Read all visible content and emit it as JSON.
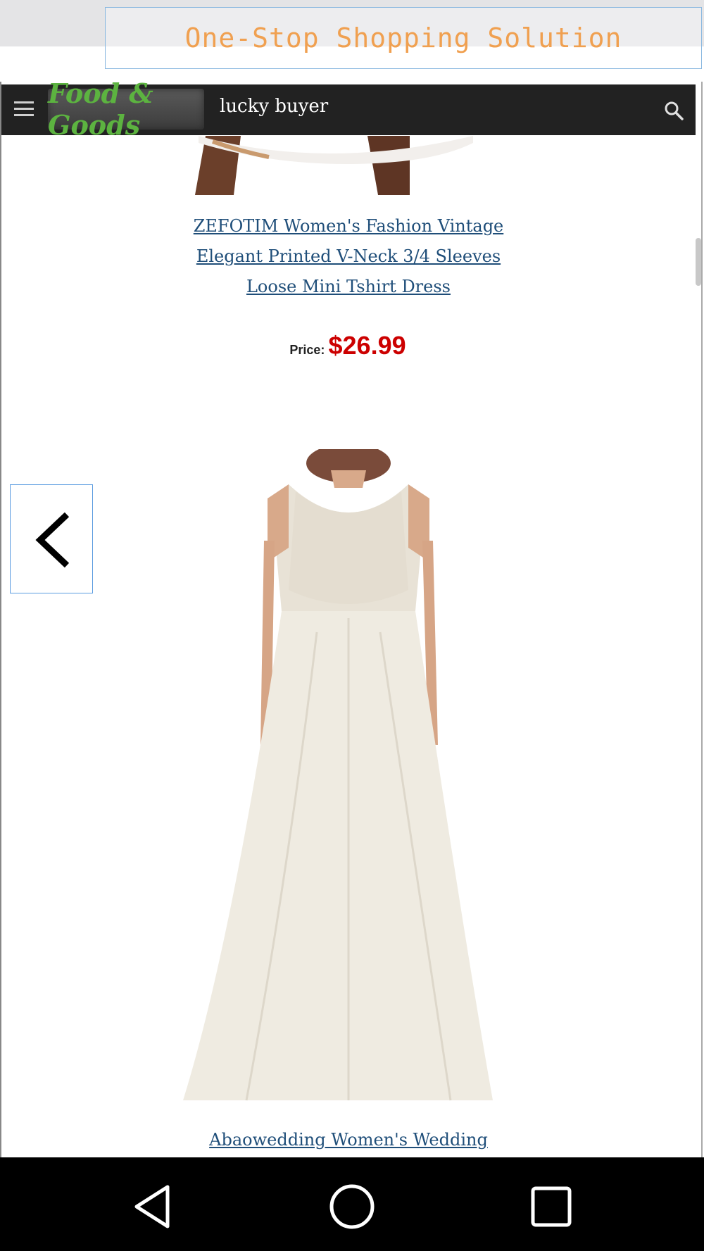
{
  "banner": {
    "text": "One-Stop Shopping Solution"
  },
  "navbar": {
    "logo_text": "Food & Goods",
    "search_value": "lucky buyer"
  },
  "products": [
    {
      "title_lines": [
        "ZEFOTIM Women's Fashion Vintage",
        "Elegant Printed V-Neck 3/4 Sleeves",
        "Loose Mini Tshirt Dress"
      ],
      "price_label": "Price:",
      "price": "$26.99"
    },
    {
      "title_lines": [
        "Abaowedding Women's Wedding"
      ]
    }
  ],
  "colors": {
    "accent_banner": "#f0a050",
    "navbar_bg": "#222222",
    "logo_green": "#5cb340",
    "link_blue": "#1f4e79",
    "price_red": "#cc0000"
  },
  "icons": [
    "menu-icon",
    "search-icon",
    "chevron-left-icon",
    "back-triangle-icon",
    "home-circle-icon",
    "recents-square-icon"
  ]
}
